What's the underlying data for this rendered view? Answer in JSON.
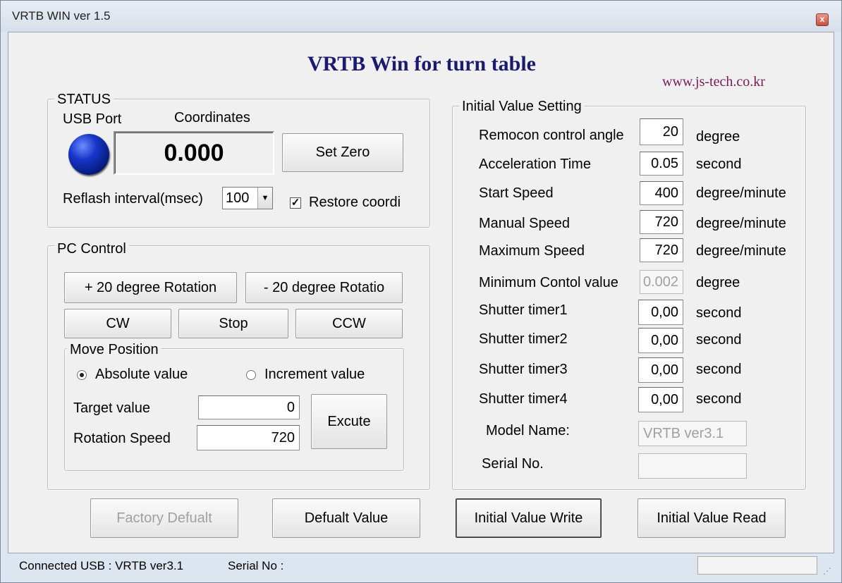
{
  "window": {
    "title": "VRTB WIN  ver 1.5",
    "close_symbol": "x"
  },
  "header": {
    "title": "VRTB Win for turn table",
    "url": "www.js-tech.co.kr"
  },
  "status": {
    "group_label": "STATUS",
    "usb_port_label": "USB Port",
    "coordinates_label": "Coordinates",
    "coordinates_value": "0.000",
    "set_zero_label": "Set Zero",
    "reflash_label": "Reflash interval(msec)",
    "reflash_value": "100",
    "restore_label": "Restore coordi",
    "restore_checked": true,
    "led_color": "#1636c8"
  },
  "pc_control": {
    "group_label": "PC Control",
    "plus_rotation_label": "+ 20 degree Rotation",
    "minus_rotation_label": "- 20 degree Rotatio",
    "cw_label": "CW",
    "stop_label": "Stop",
    "ccw_label": "CCW",
    "move_position": {
      "group_label": "Move Position",
      "absolute_label": "Absolute value",
      "increment_label": "Increment value",
      "selected": "absolute",
      "target_label": "Target value",
      "target_value": "0",
      "speed_label": "Rotation Speed",
      "speed_value": "720",
      "execute_label": "Excute"
    }
  },
  "initial": {
    "group_label": "Initial Value Setting",
    "rows": [
      {
        "label": "Remocon control angle",
        "value": "20",
        "unit": "degree"
      },
      {
        "label": "Acceleration Time",
        "value": "0.05",
        "unit": "second"
      },
      {
        "label": "Start Speed",
        "value": "400",
        "unit": "degree/minute"
      },
      {
        "label": "Manual Speed",
        "value": "720",
        "unit": "degree/minute"
      },
      {
        "label": "Maximum Speed",
        "value": "720",
        "unit": "degree/minute"
      },
      {
        "label": "Minimum Contol value",
        "value": "0.002",
        "unit": "degree"
      },
      {
        "label": "Shutter timer1",
        "value": "0,00",
        "unit": "second"
      },
      {
        "label": "Shutter timer2",
        "value": "0,00",
        "unit": "second"
      },
      {
        "label": "Shutter timer3",
        "value": "0,00",
        "unit": "second"
      },
      {
        "label": "Shutter timer4",
        "value": "0,00",
        "unit": "second"
      }
    ],
    "model_label": "Model Name:",
    "model_value": "VRTB   ver3.1",
    "serial_label": "Serial No.",
    "serial_value": ""
  },
  "buttons": {
    "factory_default": "Factory Defualt",
    "default_value": "Defualt Value",
    "initial_write": "Initial Value Write",
    "initial_read": "Initial Value Read"
  },
  "statusbar": {
    "connected": "Connected USB : VRTB ver3.1",
    "serial": "Serial No :"
  }
}
